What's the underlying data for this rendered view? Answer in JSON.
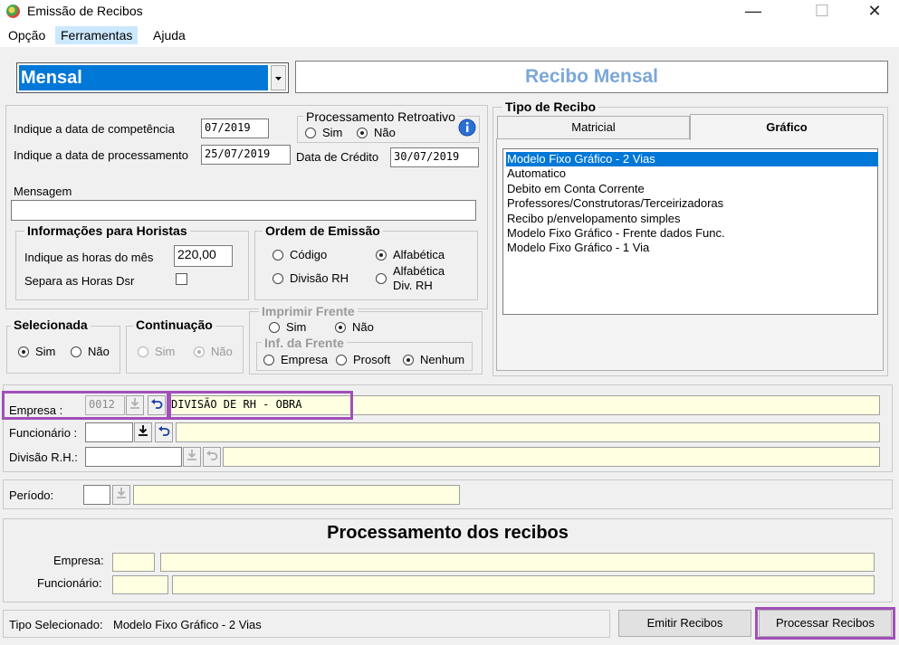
{
  "window": {
    "title": "Emissão de Recibos",
    "controls": [
      "—",
      "☐",
      "✕"
    ]
  },
  "menu": [
    "Opção",
    "Ferramentas",
    "Ajuda"
  ],
  "header": {
    "mode_select": "Mensal",
    "mode_title": "Recibo Mensal"
  },
  "dates": {
    "competencia_label": "Indique a data de competência",
    "competencia_value": "07/2019",
    "processamento_label": "Indique a data de processamento",
    "processamento_value": "25/07/2019",
    "credito_label": "Data de Crédito",
    "credito_value": "30/07/2019"
  },
  "retroativo": {
    "title": "Processamento Retroativo",
    "sim": "Sim",
    "nao": "Não",
    "selected": "Não"
  },
  "mensagem": {
    "label": "Mensagem",
    "value": ""
  },
  "horistas": {
    "title": "Informações para Horistas",
    "horas_label": "Indique as horas do mês",
    "horas_value": "220,00",
    "dsr_label": "Separa as Horas Dsr"
  },
  "ordem": {
    "title": "Ordem de Emissão",
    "codigo": "Código",
    "alfabetica": "Alfabética",
    "divisao": "Divisão RH",
    "alfa_div_1": "Alfabética",
    "alfa_div_2": "Div.  RH",
    "selected": "Alfabética"
  },
  "selecionada": {
    "title": "Selecionada",
    "sim": "Sim",
    "nao": "Não",
    "selected": "Sim"
  },
  "continuacao": {
    "title": "Continuação",
    "sim": "Sim",
    "nao": "Não",
    "selected": "Não"
  },
  "imprimir_frente": {
    "title": "Imprimir Frente",
    "sim": "Sim",
    "nao": "Não",
    "selected": "Não"
  },
  "inf_frente": {
    "title": "Inf. da Frente",
    "empresa": "Empresa",
    "prosoft": "Prosoft",
    "nenhum": "Nenhum",
    "selected": "Nenhum"
  },
  "tipo_recibo": {
    "title": "Tipo de Recibo",
    "tabs": [
      "Matricial",
      "Gráfico"
    ],
    "active_tab": "Gráfico",
    "items": [
      "Modelo Fixo Gráfico - 2 Vias",
      "Automatico",
      "Debito em Conta Corrente",
      "Professores/Construtoras/Terceirizadoras",
      "Recibo p/envelopamento simples",
      "Modelo Fixo Gráfico - Frente dados Func.",
      "Modelo Fixo Gráfico - 1 Via"
    ],
    "selected_index": 0
  },
  "filters": {
    "empresa_label": "Empresa :",
    "empresa_code": "0012",
    "empresa_name": "DIVISÃO DE RH - OBRA",
    "funcionario_label": "Funcionário :",
    "divisao_label": "Divisão R.H.:",
    "periodo_label": "Período:"
  },
  "processamento": {
    "title": "Processamento dos recibos",
    "empresa_label": "Empresa:",
    "funcionario_label": "Funcionário:"
  },
  "status": {
    "tipo_label": "Tipo Selecionado:",
    "tipo_value": "Modelo Fixo Gráfico - 2 Vias",
    "emitir": "Emitir Recibos",
    "processar": "Processar Recibos"
  },
  "colors": {
    "highlight": "#a050b8",
    "selection": "#0078d7",
    "title_blue": "#7ba7d7",
    "readonly_field": "#ffffe1"
  },
  "icons": [
    "app-icon",
    "info-icon",
    "dropdown-arrow-icon",
    "download-icon",
    "undo-icon"
  ]
}
